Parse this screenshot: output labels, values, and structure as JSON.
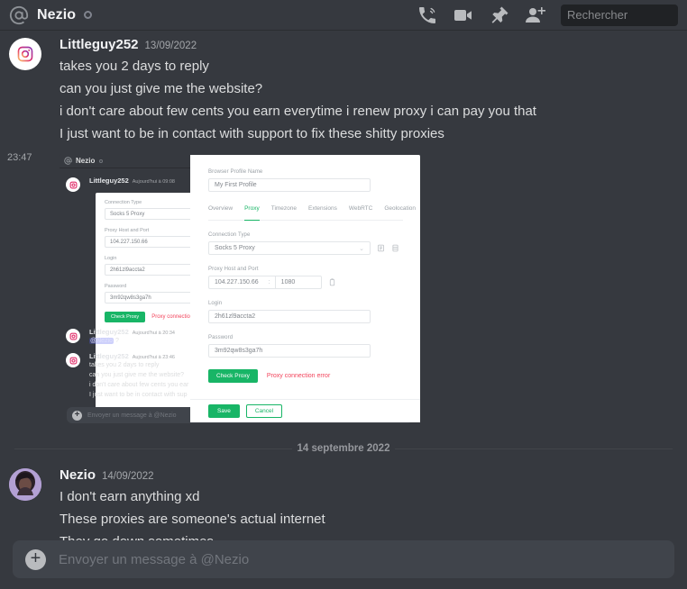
{
  "topbar": {
    "at_icon": "at-icon",
    "title": "Nezio",
    "status": "idle",
    "icons": [
      "call-icon",
      "video-call-icon",
      "pin-icon",
      "add-friend-icon"
    ],
    "search_placeholder": "Rechercher"
  },
  "messages": [
    {
      "author": "Littleguy252",
      "timestamp": "13/09/2022",
      "avatar": "instagram-logo-avatar",
      "lines": [
        "takes you 2 days to reply",
        "can you just give me the website?",
        "i don't care about few cents you earn everytime i renew proxy i can pay you that",
        "I just want to be in contact with support to fix these shitty proxies"
      ]
    },
    {
      "gutter_time": "23:47",
      "attachment": "proxy-settings-screenshot"
    }
  ],
  "attachment": {
    "inner_discord": {
      "at_icon": "at-icon",
      "title": "Nezio",
      "groups": [
        {
          "author": "Littleguy252",
          "timestamp": "Aujourd'hui à 09:08",
          "lines": []
        },
        {
          "author": "Littleguy252",
          "timestamp": "Aujourd'hui à 20:34",
          "mention": "@Nezio",
          "lines": [
            "?"
          ]
        },
        {
          "author": "Littleguy252",
          "timestamp": "Aujourd'hui à 23:46",
          "lines": [
            "takes you 2 days to reply",
            "can you just give me the website?",
            "i don't care about few cents you ear",
            "I just want to be in contact with sup"
          ]
        }
      ],
      "composer_placeholder": "Envoyer un message à @Nezio"
    },
    "proxy_dialog": {
      "profile_name_label": "Browser Profile Name",
      "profile_name_value": "My First Profile",
      "tabs": [
        {
          "label": "Overview",
          "active": false
        },
        {
          "label": "Proxy",
          "active": true
        },
        {
          "label": "Timezone",
          "active": false
        },
        {
          "label": "Extensions",
          "active": false
        },
        {
          "label": "WebRTC",
          "active": false
        },
        {
          "label": "Geolocation",
          "active": false
        }
      ],
      "connection_type_label": "Connection Type",
      "connection_type_value": "Socks 5 Proxy",
      "host_label": "Proxy Host and Port",
      "host_value": "104.227.150.66",
      "host_separator": ":",
      "port_value": "1080",
      "login_label": "Login",
      "login_value": "2h61zl9accta2",
      "password_label": "Password",
      "password_value": "3m92qw8s3ga7h",
      "check_button": "Check Proxy",
      "error_text": "Proxy connection error",
      "save_button": "Save",
      "cancel_button": "Cancel",
      "accent_color": "#18b566",
      "error_color": "#f2435b"
    }
  },
  "divider": {
    "label": "14 septembre 2022"
  },
  "nezio_message": {
    "author": "Nezio",
    "timestamp": "14/09/2022",
    "avatar": "nezio-photo-avatar",
    "lines": [
      "I don't earn anything xd",
      "These proxies are someone's actual internet",
      "They go down sometimes"
    ]
  },
  "composer": {
    "plus_icon": "plus-icon",
    "placeholder": "Envoyer un message à @Nezio"
  }
}
